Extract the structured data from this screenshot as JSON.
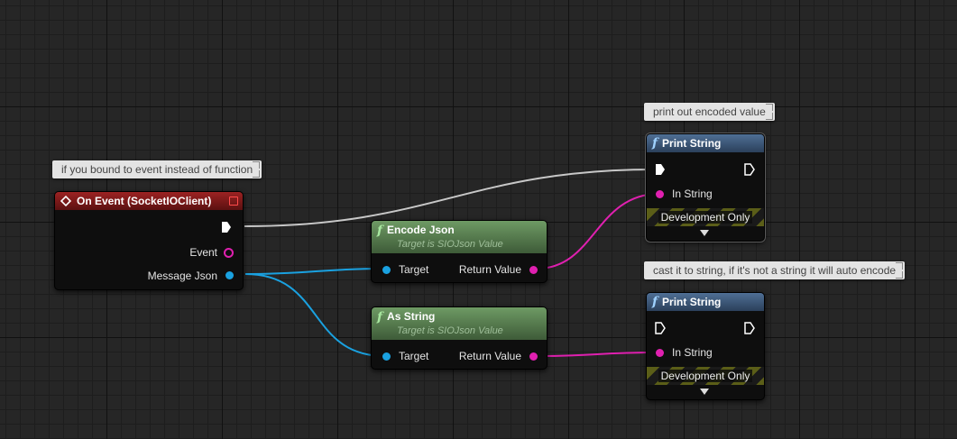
{
  "comments": {
    "event_comment": "if you bound to event instead of function",
    "print1_comment": "print out encoded value",
    "print2_comment": "cast it to string, if it's not a string it will auto encode"
  },
  "event_node": {
    "title": "On Event (SocketIOClient)",
    "pin_event": "Event",
    "pin_message": "Message Json"
  },
  "encode_node": {
    "title": "Encode Json",
    "subtitle": "Target is SIOJson Value",
    "pin_target": "Target",
    "pin_return": "Return Value"
  },
  "asstring_node": {
    "title": "As String",
    "subtitle": "Target is SIOJson Value",
    "pin_target": "Target",
    "pin_return": "Return Value"
  },
  "print1_node": {
    "title": "Print String",
    "pin_in": "In String",
    "dev": "Development Only"
  },
  "print2_node": {
    "title": "Print String",
    "pin_in": "In String",
    "dev": "Development Only"
  },
  "colors": {
    "exec_wire": "#c8c8c8",
    "object_wire": "#1aa1e0",
    "string_wire": "#e020b0",
    "event_header": "#9c2222",
    "pure_header": "#5f8a55",
    "function_header": "#3f5f85"
  },
  "icons": [
    "event-diamond-icon",
    "function-f-icon",
    "exec-arrow-icon",
    "delegate-pin-icon"
  ]
}
